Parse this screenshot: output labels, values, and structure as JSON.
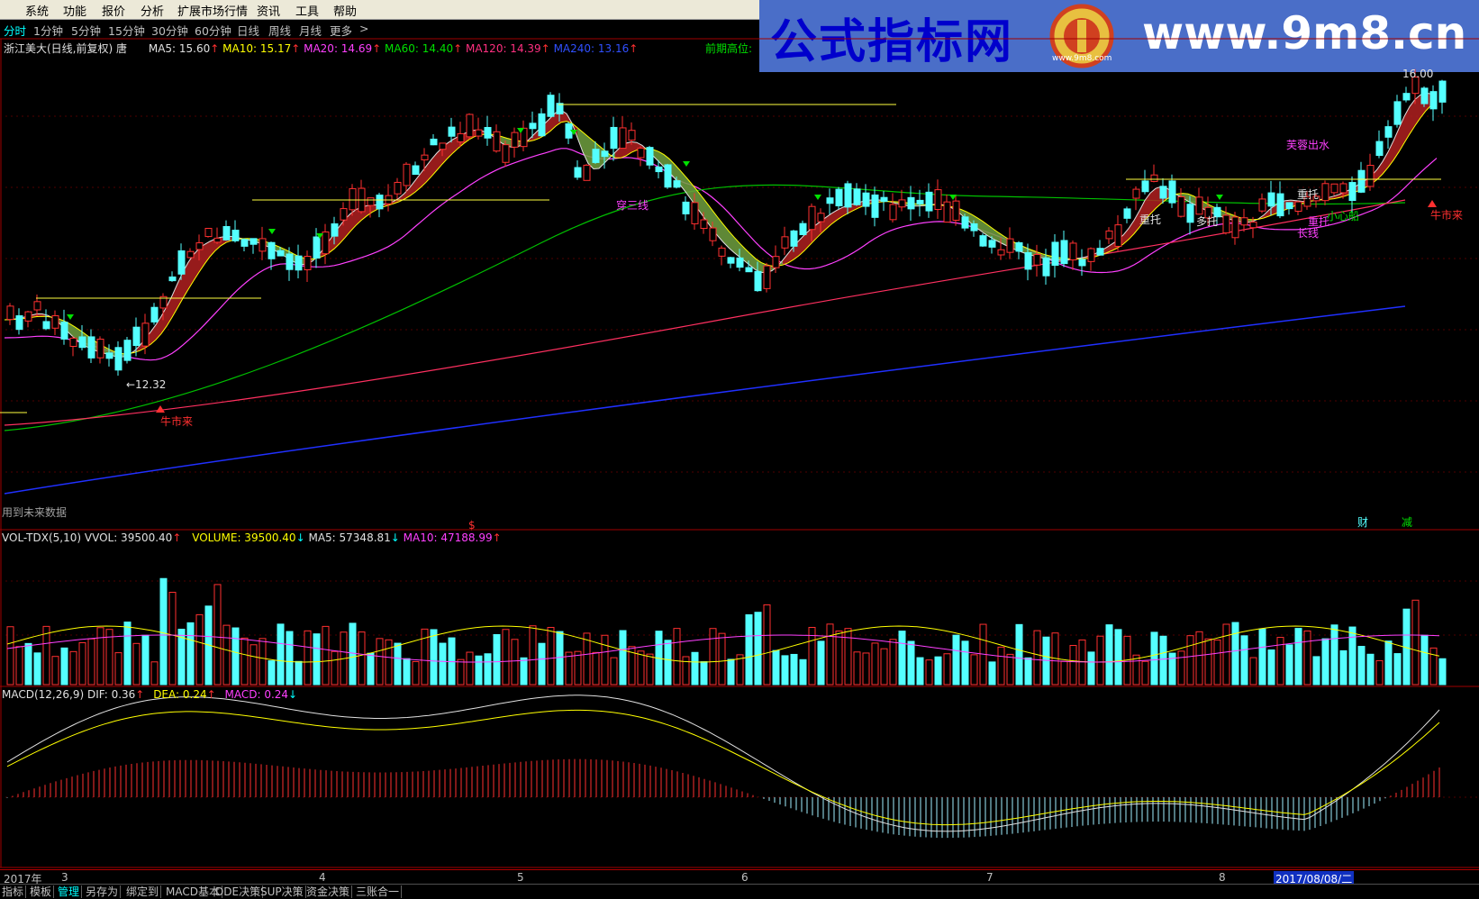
{
  "menu": [
    "系统",
    "功能",
    "报价",
    "分析",
    "扩展市场行情",
    "资讯",
    "工具",
    "帮助"
  ],
  "periods": [
    "分时",
    "1分钟",
    "5分钟",
    "15分钟",
    "30分钟",
    "60分钟",
    "日线",
    "周线",
    "月线",
    "更多",
    ">"
  ],
  "active_period": "分时",
  "banner": {
    "title": "公式指标网",
    "url": "www.9m8.cn",
    "logo_sub": "www.9m8.com"
  },
  "main_info": {
    "stock": "浙江美大(日线,前复权)",
    "suffix": "唐",
    "ma5": "MA5: 15.60",
    "ma10": "MA10: 15.17",
    "ma20": "MA20: 14.69",
    "ma60": "MA60: 14.40",
    "ma120": "MA120: 14.39",
    "ma240": "MA240: 13.16",
    "prev_high": "前期高位: ",
    "future_data": "用到未来数据",
    "high_label": "16.00"
  },
  "annotations": {
    "low_price": "←12.32",
    "bull1": "牛市来",
    "bull2": "牛市来",
    "chuan": "穿三线",
    "furong": "芙蓉出水",
    "zhongtuo1": "重托",
    "zhongtuo2": "重托",
    "zhongtuo3": "重托",
    "duotuo": "多托",
    "xiaoxin": "小心船",
    "changxian": "长线",
    "cai": "财",
    "jian": "减",
    "dollar": "$"
  },
  "vol_info": {
    "name": "VOL-TDX(5,10)",
    "vvol": "VVOL: 39500.40",
    "volume": "VOLUME: 39500.40",
    "ma5": "MA5: 57348.81",
    "ma10": "MA10: 47188.99"
  },
  "macd_info": {
    "name": "MACD(12,26,9)",
    "dif": "DIF: 0.36",
    "dea": "DEA: 0.24",
    "macd": "MACD: 0.24"
  },
  "date_axis": [
    "2017年",
    "3",
    "4",
    "5",
    "6",
    "7",
    "8"
  ],
  "cursor_date": "2017/08/08/二",
  "bottom_tabs": [
    "指标",
    "模板",
    "管理",
    "另存为",
    "绑定到",
    "MACD基本",
    "DDE决策",
    "SUP决策",
    "资金决策",
    "三账合一"
  ],
  "active_tab": "管理",
  "colors": {
    "up": "#ff3030",
    "down": "#54ffff",
    "ma5": "#e0e0e0",
    "ma10": "#ffff00",
    "ma20": "#ff40ff",
    "ma60": "#00c000",
    "ma120": "#ff3060",
    "ma240": "#2030ff",
    "band_up": "#b02020",
    "band_dn": "#70a040"
  }
}
